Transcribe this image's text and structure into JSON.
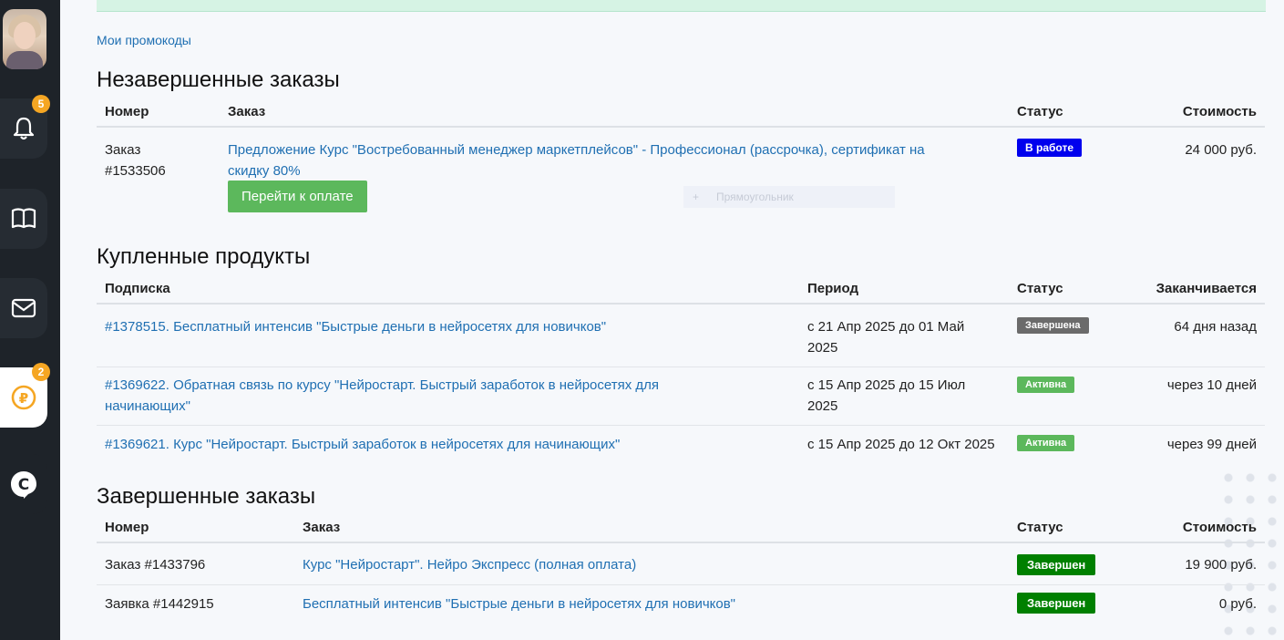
{
  "sidebar": {
    "notifications_badge": "5",
    "payments_badge": "2",
    "payments_icon_glyph": "₽",
    "brand_icon_glyph": "C",
    "icons": [
      "bell-icon",
      "book-icon",
      "mail-icon",
      "ruble-icon",
      "brand-c-icon"
    ]
  },
  "promo_link": "Мои промокоды",
  "unfinished": {
    "title": "Незавершенные заказы",
    "headers": {
      "number": "Номер",
      "order": "Заказ",
      "status": "Статус",
      "cost": "Стоимость"
    },
    "rows": [
      {
        "number_line1": "Заказ",
        "number_line2": "#1533506",
        "order_line1": "Предложение Курс \"Востребованный менеджер маркетплейсов\" - Профессионал (рассрочка), сертификат на",
        "order_line2": "скидку 80%",
        "pay_button": "Перейти к оплате",
        "status": "В работе",
        "cost": "24 000 руб."
      }
    ],
    "ghost_label": "Прямоугольник"
  },
  "purchased": {
    "title": "Купленные продукты",
    "headers": {
      "subscription": "Подписка",
      "period": "Период",
      "status": "Статус",
      "ends": "Заканчивается"
    },
    "rows": [
      {
        "sub_line1": "#1378515. Бесплатный интенсив \"Быстрые деньги в нейросетях для новичков\"",
        "sub_line2": "",
        "period_line1": "с 21 Апр 2025 до 01 Май",
        "period_line2": "2025",
        "status": "Завершена",
        "ends": "64 дня назад"
      },
      {
        "sub_line1": "#1369622. Обратная связь по курсу \"Нейростарт. Быстрый заработок в нейросетях для",
        "sub_line2": "начинающих\"",
        "period_line1": "с 15 Апр 2025 до 15 Июл",
        "period_line2": "2025",
        "status": "Активна",
        "ends": "через 10 дней"
      },
      {
        "sub_line1": "#1369621. Курс \"Нейростарт. Быстрый заработок в нейросетях для начинающих\"",
        "sub_line2": "",
        "period_line1": "с 15 Апр 2025 до 12 Окт 2025",
        "period_line2": "",
        "status": "Активна",
        "ends": "через 99 дней"
      }
    ]
  },
  "finished": {
    "title": "Завершенные заказы",
    "headers": {
      "number": "Номер",
      "order": "Заказ",
      "status": "Статус",
      "cost": "Стоимость"
    },
    "rows": [
      {
        "number": "Заказ #1433796",
        "order": "Курс \"Нейростарт\". Нейро Экспресс (полная оплата)",
        "status": "Завершен",
        "cost": "19 900 руб."
      },
      {
        "number": "Заявка #1442915",
        "order": "Бесплатный интенсив \"Быстрые деньги в нейросетях для новичков\"",
        "status": "Завершен",
        "cost": "0 руб."
      }
    ]
  },
  "colors": {
    "sidebar_bg": "#1e2329",
    "link": "#1f6fb2",
    "status_in_work": "#0000ee",
    "status_completed_grey": "#6b6b6b",
    "status_active": "#5cb85c",
    "status_done": "#008000",
    "pay_button": "#5cb85c",
    "badge": "#f5a623"
  }
}
